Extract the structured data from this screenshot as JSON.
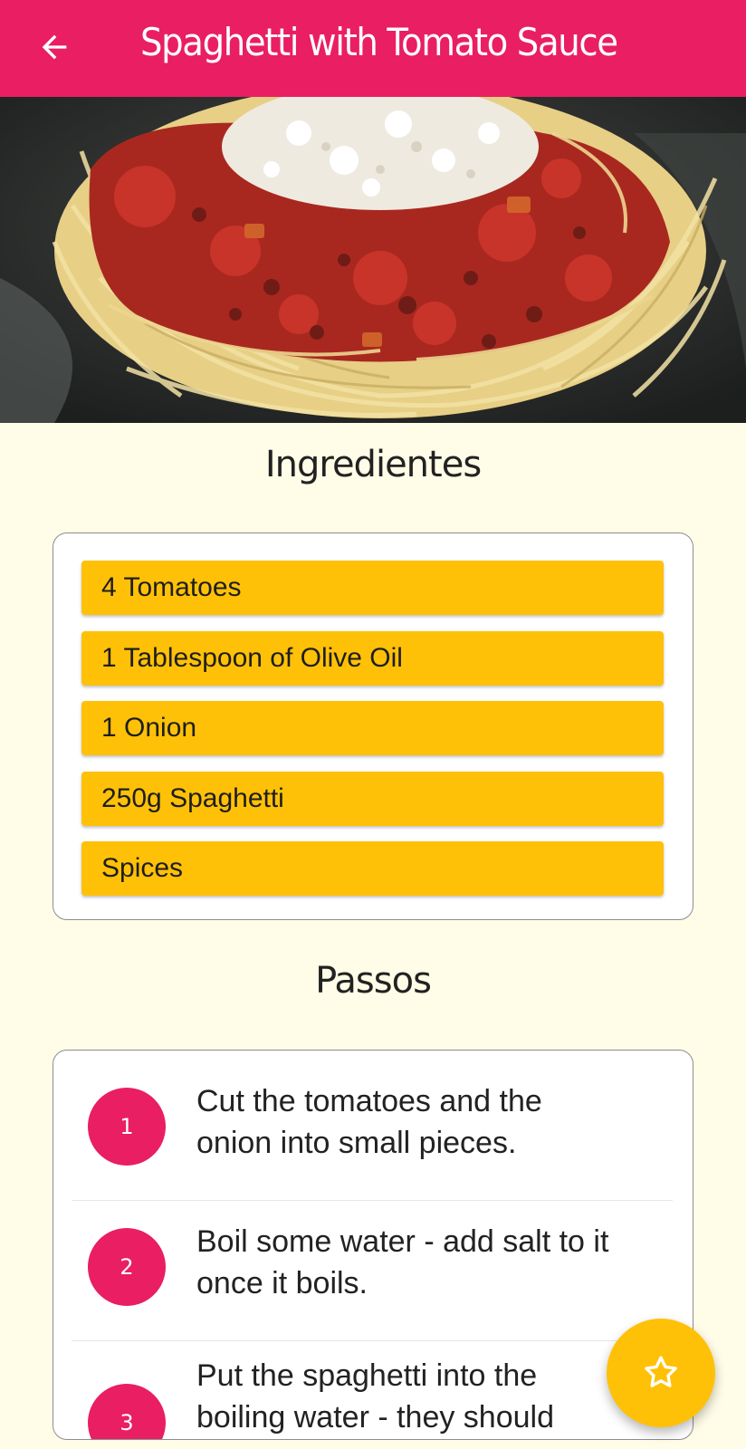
{
  "appbar": {
    "title": "Spaghetti with Tomato Sauce",
    "back_icon": "arrow-left-icon"
  },
  "hero": {
    "alt": "Spaghetti with Tomato Sauce"
  },
  "ingredients": {
    "heading": "Ingredientes",
    "items": [
      "4 Tomatoes",
      "1 Tablespoon of Olive Oil",
      "1 Onion",
      "250g Spaghetti",
      "Spices"
    ]
  },
  "steps": {
    "heading": "Passos",
    "items": [
      {
        "number": "1",
        "text": "Cut the tomatoes and the onion into small pieces."
      },
      {
        "number": "2",
        "text": "Boil some water - add salt to it once it boils."
      },
      {
        "number": "3",
        "text": "Put the spaghetti into the boiling water - they should"
      }
    ]
  },
  "fab": {
    "icon": "star-outline-icon"
  },
  "colors": {
    "primary": "#e91e63",
    "accent": "#ffc107",
    "background": "#fffde7"
  }
}
